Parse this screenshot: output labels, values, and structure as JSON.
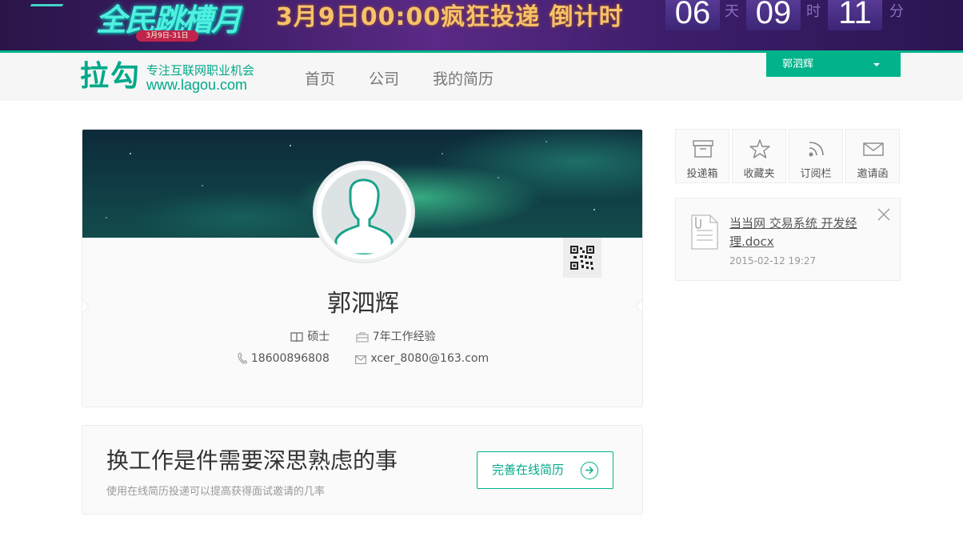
{
  "banner": {
    "logo_text": "全民跳槽月",
    "logo_sub": "3月9日-31日",
    "headline": "3月9日00:00疯狂投递 倒计时",
    "countdown": [
      {
        "value": "06",
        "unit": "天"
      },
      {
        "value": "09",
        "unit": "时"
      },
      {
        "value": "11",
        "unit": "分"
      }
    ]
  },
  "header": {
    "logo": "拉勾",
    "slogan": "专注互联网职业机会",
    "url": "www.lagou.com",
    "nav": [
      "首页",
      "公司",
      "我的简历"
    ],
    "user_name": "郭泗辉"
  },
  "profile": {
    "name": "郭泗辉",
    "degree": "硕士",
    "experience": "7年工作经验",
    "phone": "18600896808",
    "email": "xcer_8080@163.com"
  },
  "tip": {
    "title": "换工作是件需要深思熟虑的事",
    "subtitle": "使用在线简历投递可以提高获得面试邀请的几率",
    "button_label": "完善在线简历"
  },
  "tools": [
    {
      "label": "投递箱",
      "icon": "inbox-icon"
    },
    {
      "label": "收藏夹",
      "icon": "star-icon"
    },
    {
      "label": "订阅栏",
      "icon": "rss-icon"
    },
    {
      "label": "邀请函",
      "icon": "envelope-icon"
    }
  ],
  "attachment": {
    "file_name": "当当网 交易系统 开发经理.docx",
    "date": "2015-02-12 19:27"
  },
  "colors": {
    "brand": "#00b38a",
    "banner_bg": "#3b1b63"
  }
}
